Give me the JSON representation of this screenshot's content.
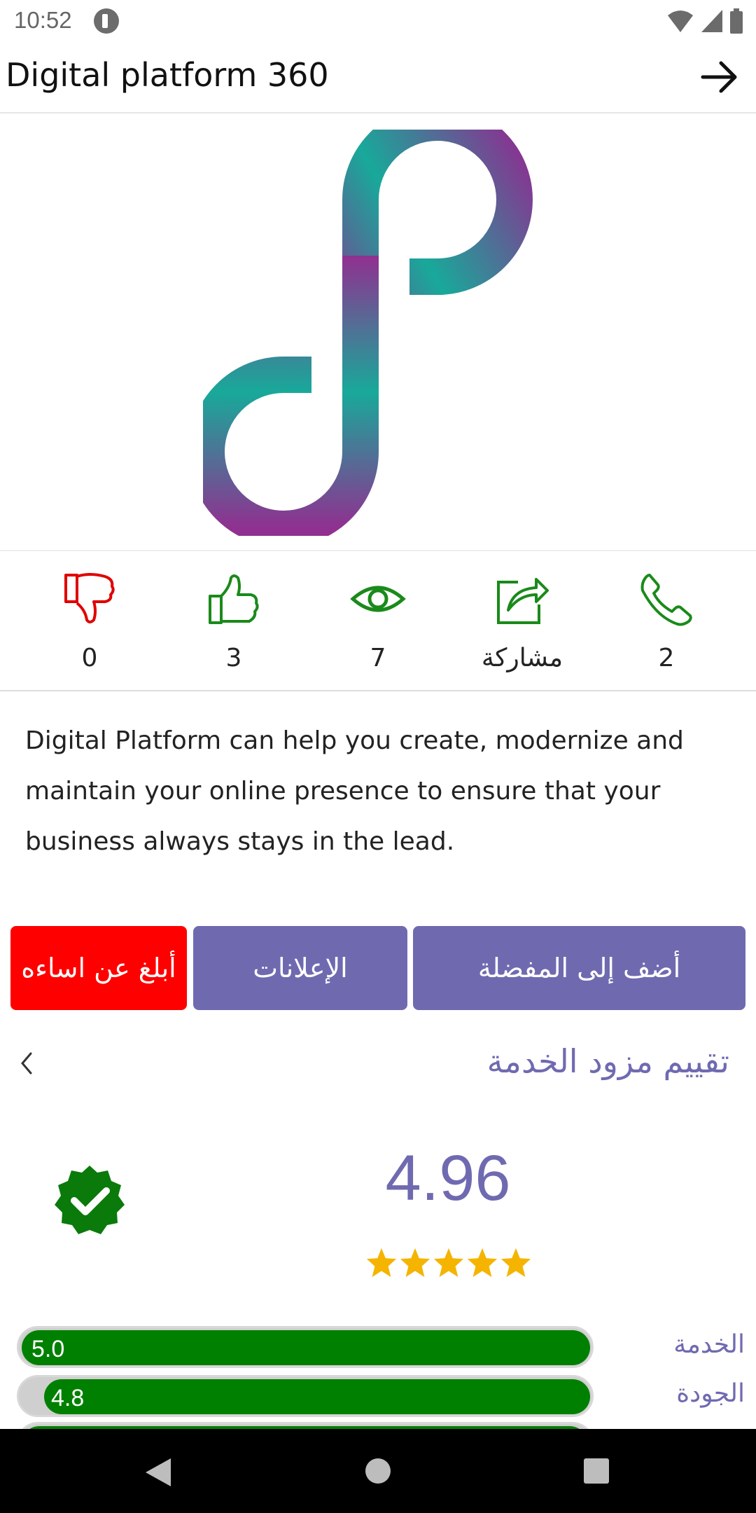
{
  "status_bar": {
    "time": "10:52"
  },
  "app_bar": {
    "title": "Digital platform 360"
  },
  "stats": {
    "dislikes": "0",
    "likes": "3",
    "views": "7",
    "share_label": "مشاركة",
    "calls": "2"
  },
  "description": "Digital Platform can help you create, modernize and maintain your online presence to ensure that your business always stays in the lead.",
  "buttons": {
    "report": "أبلغ عن اساءه",
    "ads": "الإعلانات",
    "favorite": "أضف إلى المفضلة"
  },
  "rating": {
    "title": "تقييم مزود الخدمة",
    "score": "4.96",
    "stars": 5,
    "bars": [
      {
        "label": "الخدمة",
        "value": "5.0",
        "fraction": 1.0
      },
      {
        "label": "الجودة",
        "value": "4.8",
        "fraction": 0.96
      }
    ]
  },
  "colors": {
    "accent": "#6f6ab0",
    "report_red": "#ff0000",
    "green": "#008000",
    "star": "#f5b400"
  },
  "icons": [
    "dislike-icon",
    "like-icon",
    "eye-icon",
    "share-icon",
    "phone-icon",
    "verified-icon",
    "star-icon"
  ]
}
